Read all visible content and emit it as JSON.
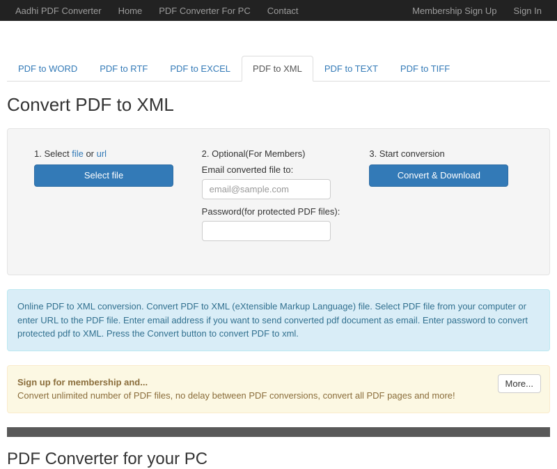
{
  "navbar": {
    "brand": "Aadhi PDF Converter",
    "left": [
      "Home",
      "PDF Converter For PC",
      "Contact"
    ],
    "right": [
      "Membership Sign Up",
      "Sign In"
    ]
  },
  "tabs": [
    "PDF to WORD",
    "PDF to RTF",
    "PDF to EXCEL",
    "PDF to XML",
    "PDF to TEXT",
    "PDF to TIFF"
  ],
  "activeTab": 3,
  "heading": "Convert PDF to XML",
  "step1": {
    "prefix": "1. Select ",
    "fileLink": "file",
    "or": " or ",
    "urlLink": "url",
    "button": "Select file"
  },
  "step2": {
    "label": "2. Optional(For Members)",
    "sub1": "Email converted file to:",
    "placeholder": "email@sample.com",
    "sub2": "Password(for protected PDF files):"
  },
  "step3": {
    "label": "3. Start conversion",
    "button": "Convert & Download"
  },
  "info": "Online PDF to XML conversion. Convert PDF to XML (eXtensible Markup Language) file. Select PDF file from your computer or enter URL to the PDF file. Enter email address if you want to send converted pdf document as email. Enter password to convert protected pdf to XML. Press the Convert button to convert PDF to xml.",
  "warning": {
    "strong": "Sign up for membership and...",
    "text": "Convert unlimited number of PDF files, no delay between PDF conversions, convert all PDF pages and more!",
    "more": "More..."
  },
  "pcHeading": "PDF Converter for your PC"
}
